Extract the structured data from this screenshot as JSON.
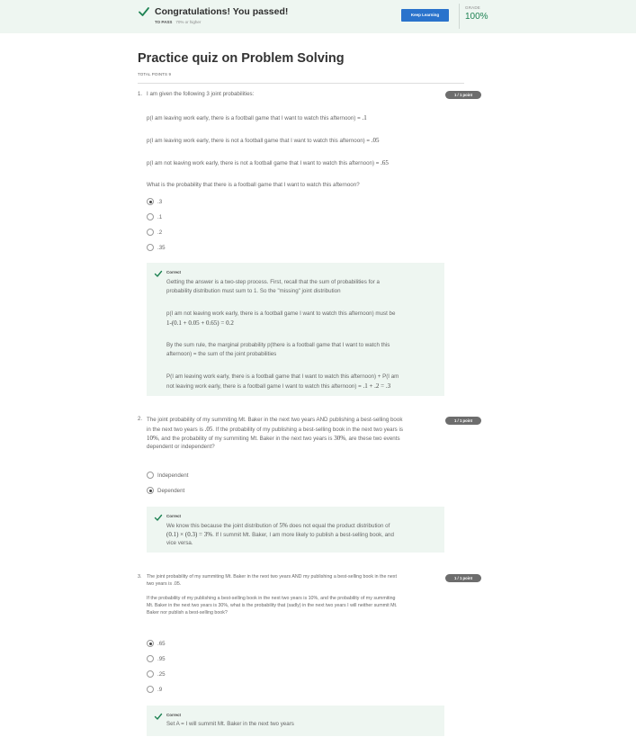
{
  "banner": {
    "title": "Congratulations! You passed!",
    "to_pass_label": "TO PASS",
    "to_pass_value": "70% or higher",
    "keep_learning": "Keep Learning",
    "grade_label": "GRADE",
    "grade_value": "100%"
  },
  "quiz": {
    "title": "Practice quiz on Problem Solving",
    "total_points": "TOTAL POINTS 9"
  },
  "questions": [
    {
      "number": "1.",
      "points": "1 / 1 point",
      "intro": "I am given the following 3 joint probabilities:",
      "lines": [
        "p(I am leaving work early, there is a football game that I want to watch this afternoon) = ",
        "p(I am leaving work early, there is not a football game that I want to watch this afternoon) = ",
        "p(I am not leaving work early, there is not a football game that I want to watch this afternoon) = "
      ],
      "line_values": [
        ".1",
        ".05",
        ".65"
      ],
      "prompt": "What is the probability that there is a football game that I want to watch this afternoon?",
      "options": [
        ".3",
        ".1",
        ".2",
        ".35"
      ],
      "selected": 0,
      "feedback": {
        "title": "Correct",
        "p1_a": "Getting the answer is a two-step process. First, recall that the sum of probabilities for a",
        "p1_b": "probability distribution must sum to 1. So the \"missing\" joint distribution",
        "p2_a": "p(I am not leaving work early, there is a football game I want to watch this afternoon) must be",
        "p2_b": "1-(0.1 + 0.05 + 0.65) = 0.2",
        "p3_a": "By the sum rule, the marginal probability p(there is a football game that I want to watch this",
        "p3_b": "afternoon) = the sum of the joint probabilities",
        "p4_a": "P(I am leaving work early, there is a football game that I want to watch this afternoon) + P(I am",
        "p4_b": "not leaving work early, there is a football game I want to watch this afternoon) = ",
        "p4_math": ".1 + .2 = .3"
      }
    },
    {
      "number": "2.",
      "points": "1 / 1 point",
      "text_1a": "The joint probability of my summiting Mt. Baker in the next two years AND publishing a best-selling book",
      "text_2a": "in the next two years is ",
      "text_2m": ".05",
      "text_2b": ". If the probability of my publishing a best-selling book in the next two years is",
      "text_3m1": "10%",
      "text_3a": ", and the probability of my summiting Mt. Baker in the next two years is ",
      "text_3m2": "30%",
      "text_3b": ", are these two events",
      "text_4": "dependent or independent?",
      "options": [
        "Independent",
        "Dependent"
      ],
      "selected": 1,
      "feedback": {
        "title": "Correct",
        "l1a": "We know this because the joint distribution of ",
        "l1m": "5%",
        "l1b": " does not equal the product distribution of",
        "l2m": "(0.1) × (0.3) = 3%",
        "l2b": ". If I summit Mt. Baker, I am more likely to publish a best-selling book, and",
        "l3": "vice versa."
      }
    },
    {
      "number": "3.",
      "points": "1 / 1 point",
      "l1": "The joint probability of my summiting Mt. Baker in the next two years AND my publishing a best-selling book in the next",
      "l2": "two years is .05.",
      "l3": "If the probability of my publishing a best-selling book in the next two years is 10%, and the probability of my summiting",
      "l4": "Mt. Baker in the next two years is 30%, what is the probability that (sadly) in the next two years I will neither summit Mt.",
      "l5": "Baker nor publish a best-selling book?",
      "options": [
        ".65",
        ".95",
        ".25",
        ".9"
      ],
      "selected": 0,
      "feedback": {
        "title": "Correct",
        "l1": "Set A = I will summit Mt. Baker in the next two years"
      }
    }
  ]
}
